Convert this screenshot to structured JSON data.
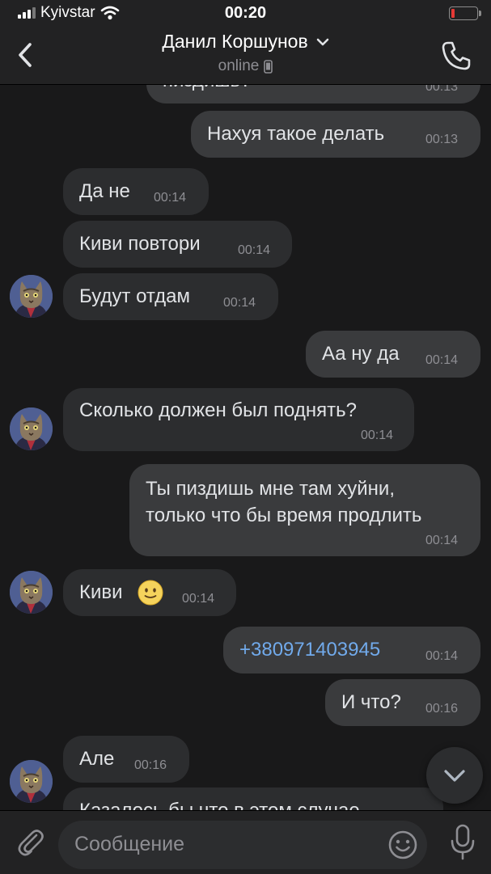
{
  "status_bar": {
    "carrier": "Kyivstar",
    "time": "00:20"
  },
  "header": {
    "contact_name": "Данил Коршунов",
    "presence": "online"
  },
  "messages": [
    {
      "dir": "out",
      "text": "пиздишь?",
      "time": "00:13"
    },
    {
      "dir": "out",
      "text": "Нахуя такое делать",
      "time": "00:13"
    },
    {
      "dir": "in",
      "text": "Да не",
      "time": "00:14"
    },
    {
      "dir": "in",
      "text": "Киви повтори",
      "time": "00:14"
    },
    {
      "dir": "in",
      "text": "Будут отдам",
      "time": "00:14"
    },
    {
      "dir": "out",
      "text": "Аа ну да",
      "time": "00:14"
    },
    {
      "dir": "in",
      "text": "Сколько должен был поднять?",
      "time": "00:14"
    },
    {
      "dir": "out",
      "text": "Ты пиздишь мне там хуйни,\nтолько что бы время продлить",
      "time": "00:14"
    },
    {
      "dir": "in",
      "text": "Киви",
      "emoji": "🙂",
      "time": "00:14"
    },
    {
      "dir": "out",
      "text": "+380971403945",
      "time": "00:14",
      "is_link": true
    },
    {
      "dir": "out",
      "text": "И что?",
      "time": "00:16"
    },
    {
      "dir": "in",
      "text": "Але",
      "time": "00:16"
    },
    {
      "dir": "in",
      "text": "Казалось бы что в этом случае",
      "time": ""
    }
  ],
  "composer": {
    "placeholder": "Сообщение"
  },
  "colors": {
    "background": "#19191a",
    "incoming": "#2c2d2f",
    "outgoing": "#3a3b3d",
    "link": "#71aaeb",
    "battery_low": "#e53935"
  },
  "icons": [
    "back-chevron-icon",
    "chevron-down-icon",
    "mobile-device-icon",
    "phone-icon",
    "attach-clip-icon",
    "emoji-smile-icon",
    "microphone-icon",
    "scroll-down-icon"
  ]
}
